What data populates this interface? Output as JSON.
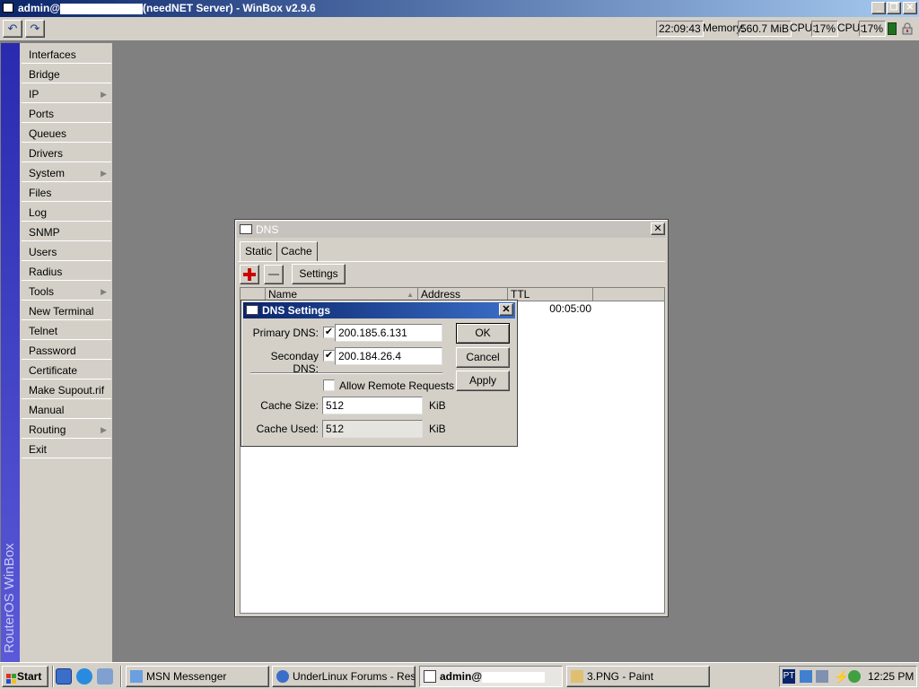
{
  "window": {
    "title_prefix": "admin@",
    "title_suffix": "(needNET Server) - WinBox v2.9.6"
  },
  "toolbar": {
    "time": "22:09:43",
    "memory_label": "Memory:",
    "memory_value": "560.7 MiB",
    "cpu_label": "CPU:",
    "cpu1_value": "17%",
    "cpu2_label": "CPU:",
    "cpu2_value": "17%"
  },
  "sidebar": {
    "brand": "RouterOS WinBox",
    "items": [
      {
        "label": "Interfaces"
      },
      {
        "label": "Bridge"
      },
      {
        "label": "IP",
        "submenu": true
      },
      {
        "label": "Ports"
      },
      {
        "label": "Queues"
      },
      {
        "label": "Drivers"
      },
      {
        "label": "System",
        "submenu": true
      },
      {
        "label": "Files"
      },
      {
        "label": "Log"
      },
      {
        "label": "SNMP"
      },
      {
        "label": "Users"
      },
      {
        "label": "Radius"
      },
      {
        "label": "Tools",
        "submenu": true
      },
      {
        "label": "New Terminal"
      },
      {
        "label": "Telnet"
      },
      {
        "label": "Password"
      },
      {
        "label": "Certificate"
      },
      {
        "label": "Make Supout.rif"
      },
      {
        "label": "Manual"
      },
      {
        "label": "Routing",
        "submenu": true
      },
      {
        "label": "Exit"
      }
    ]
  },
  "dns_window": {
    "title": "DNS",
    "tabs": [
      "Static",
      "Cache"
    ],
    "settings_button": "Settings",
    "columns": [
      "Name",
      "Address",
      "TTL"
    ],
    "row_ttl": "00:05:00"
  },
  "dns_settings": {
    "title": "DNS Settings",
    "primary_label": "Primary DNS:",
    "primary_value": "200.185.6.131",
    "secondary_label": "Seconday DNS:",
    "secondary_value": "200.184.26.4",
    "allow_remote_label": "Allow Remote Requests",
    "cache_size_label": "Cache Size:",
    "cache_size_value": "512",
    "cache_size_unit": "KiB",
    "cache_used_label": "Cache Used:",
    "cache_used_value": "512",
    "cache_used_unit": "KiB",
    "ok": "OK",
    "cancel": "Cancel",
    "apply": "Apply"
  },
  "taskbar": {
    "start": "Start",
    "tasks": [
      "MSN Messenger",
      "UnderLinux Forums - Res...",
      "admin@",
      "3.PNG - Paint"
    ],
    "lang": "PT",
    "clock": "12:25 PM"
  }
}
